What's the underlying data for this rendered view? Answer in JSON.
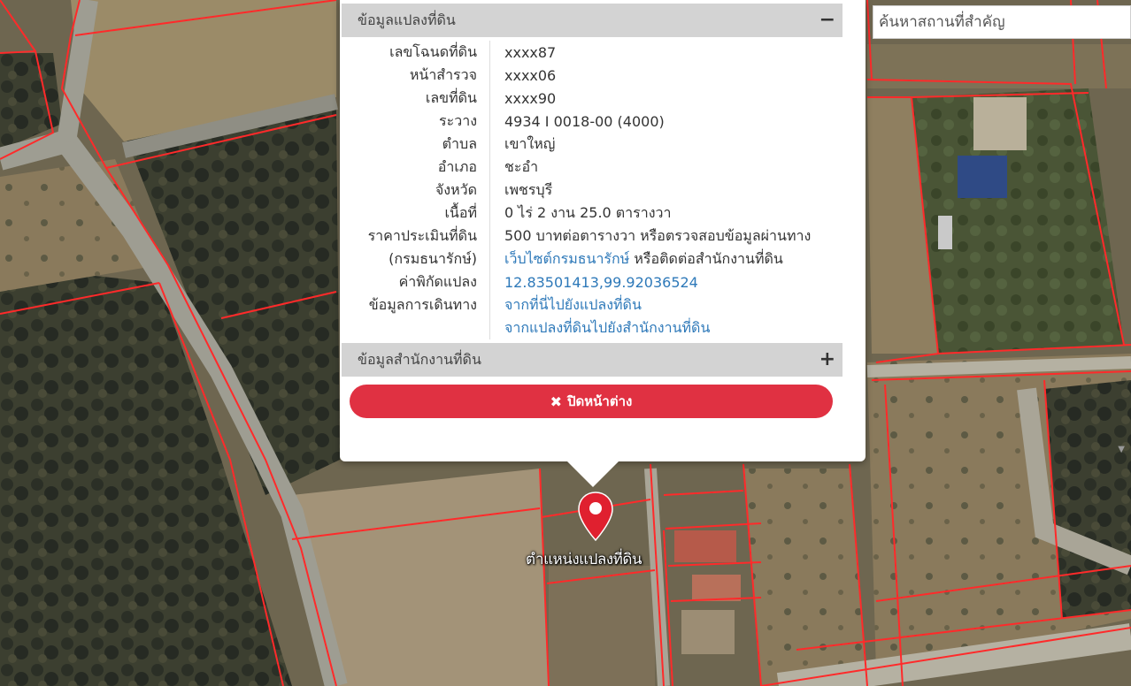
{
  "search": {
    "placeholder": "ค้นหาสถานที่สำคัญ"
  },
  "popup": {
    "land_section_title": "ข้อมูลแปลงที่ดิน",
    "land_section_toggle": "−",
    "rows": [
      {
        "label": "เลขโฉนดที่ดิน",
        "value": "xxxx87"
      },
      {
        "label": "หน้าสำรวจ",
        "value": "xxxx06"
      },
      {
        "label": "เลขที่ดิน",
        "value": "xxxx90"
      },
      {
        "label": "ระวาง",
        "value": "4934 I 0018-00 (4000)"
      },
      {
        "label": "ตำบล",
        "value": "เขาใหญ่"
      },
      {
        "label": "อำเภอ",
        "value": "ชะอำ"
      },
      {
        "label": "จังหวัด",
        "value": "เพชรบุรี"
      },
      {
        "label": "เนื้อที่",
        "value": "0 ไร่ 2 งาน 25.0 ตารางวา"
      },
      {
        "label": "ราคาประเมินที่ดิน",
        "value": "500 บาทต่อตารางวา หรือตรวจสอบข้อมูลผ่านทาง"
      }
    ],
    "dept_row": {
      "label": "(กรมธนารักษ์)",
      "link": "เว็บไซต์กรมธนารักษ์",
      "suffix": " หรือติดต่อสำนักงานที่ดิน"
    },
    "coords_row": {
      "label": "ค่าพิกัดแปลง",
      "link": "12.83501413,99.92036524"
    },
    "travel_row": {
      "label": "ข้อมูลการเดินทาง",
      "link1": "จากที่นี่ไปยังแปลงที่ดิน",
      "link2": "จากแปลงที่ดินไปยังสำนักงานที่ดิน"
    },
    "office_section_title": "ข้อมูลสำนักงานที่ดิน",
    "office_section_toggle": "+",
    "close_label": "ปิดหน้าต่าง",
    "close_icon": "✖"
  },
  "marker": {
    "label": "ตำแหน่งแปลงที่ดิน",
    "color": "#e0202f",
    "icon": "map-pin-icon"
  },
  "colors": {
    "parcel_line": "#ff2a2a",
    "button": "#e03142",
    "link": "#2e79b9"
  }
}
